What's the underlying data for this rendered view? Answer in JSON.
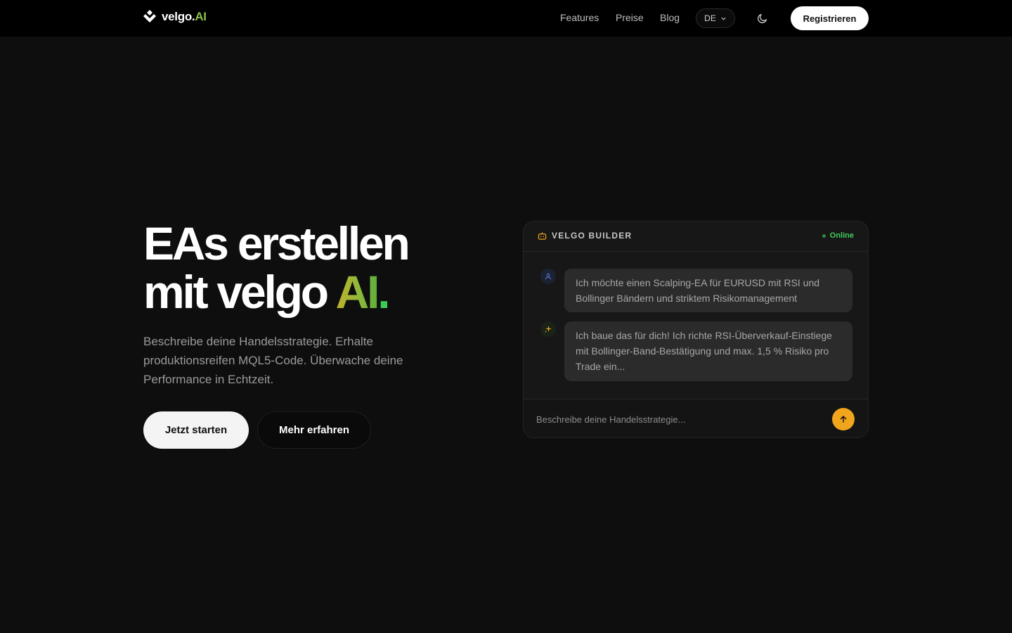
{
  "header": {
    "brand_name": "velgo.",
    "brand_ai": "AI",
    "nav": [
      "Features",
      "Preise",
      "Blog"
    ],
    "language": "DE",
    "theme_icon": "moon-icon",
    "register_label": "Registrieren"
  },
  "hero": {
    "title_line1": "EAs erstellen",
    "title_line2_prefix": "mit velgo ",
    "title_ai": "AI",
    "title_dot": ".",
    "subtitle": "Beschreibe deine Handelsstrategie. Erhalte produktionsreifen MQL5-Code. Überwache deine Performance in Echtzeit.",
    "primary_cta": "Jetzt starten",
    "secondary_cta": "Mehr erfahren"
  },
  "chat": {
    "title": "VELGO BUILDER",
    "status": "Online",
    "messages": [
      {
        "role": "user",
        "icon": "user-icon",
        "text": "Ich möchte einen Scalping-EA für EURUSD mit RSI und Bollinger Bändern und striktem Risikomanagement"
      },
      {
        "role": "assistant",
        "icon": "sparkle-icon",
        "text": "Ich baue das für dich! Ich richte RSI-Überverkauf-Einstiege mit Bollinger-Band-Bestätigung und max. 1,5 % Risiko pro Trade ein..."
      }
    ],
    "input_placeholder": "Beschreibe deine Handelsstrategie...",
    "send_icon": "arrow-up-icon"
  },
  "colors": {
    "background": "#0e0e0e",
    "header": "#000000",
    "accent_green": "#3ccb58",
    "accent_orange": "#f0a51d",
    "status_green": "#3fcf5e"
  }
}
